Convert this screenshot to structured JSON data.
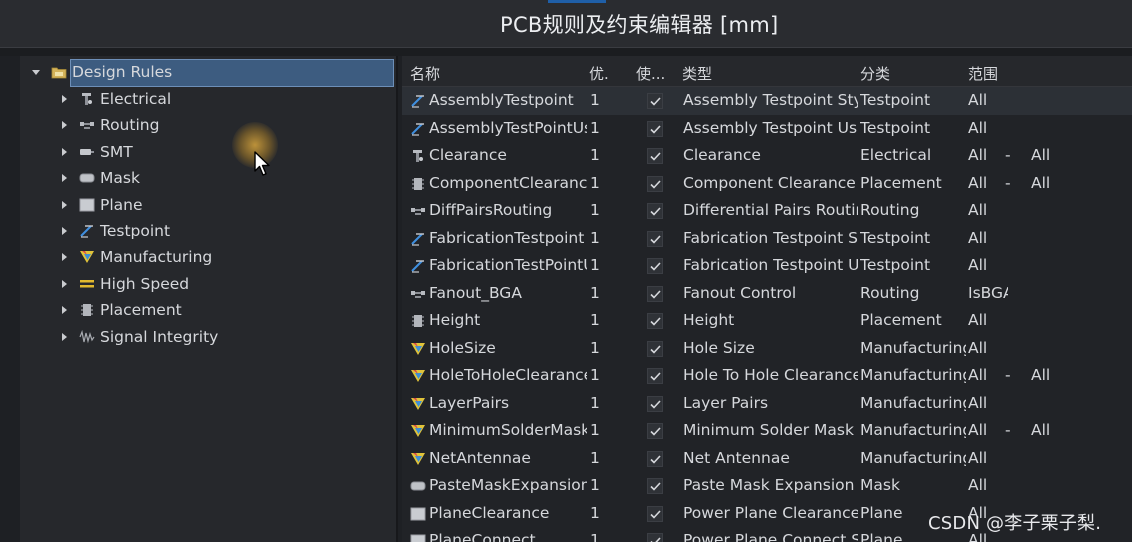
{
  "window": {
    "title": "PCB规则及约束编辑器 [mm]"
  },
  "tree": {
    "root": {
      "label": "Design Rules",
      "icon": "folder-icon"
    },
    "items": [
      {
        "label": "Electrical",
        "icon": "electrical-icon"
      },
      {
        "label": "Routing",
        "icon": "routing-icon"
      },
      {
        "label": "SMT",
        "icon": "smt-icon"
      },
      {
        "label": "Mask",
        "icon": "mask-icon"
      },
      {
        "label": "Plane",
        "icon": "plane-icon"
      },
      {
        "label": "Testpoint",
        "icon": "testpoint-icon"
      },
      {
        "label": "Manufacturing",
        "icon": "manufacturing-icon"
      },
      {
        "label": "High Speed",
        "icon": "high-speed-icon"
      },
      {
        "label": "Placement",
        "icon": "placement-icon"
      },
      {
        "label": "Signal Integrity",
        "icon": "signal-integrity-icon"
      }
    ]
  },
  "grid": {
    "columns": {
      "name": "名称",
      "priority": "优.",
      "enabled": "使...",
      "type": "类型",
      "category": "分类",
      "scope": "范围"
    },
    "rows": [
      {
        "name": "AssemblyTestpoint",
        "priority": "1",
        "enabled": true,
        "type": "Assembly Testpoint Styl",
        "category": "Testpoint",
        "scope1": "All",
        "dash": "",
        "scope2": "",
        "icon": "testpoint-icon"
      },
      {
        "name": "AssemblyTestPointUs",
        "priority": "1",
        "enabled": true,
        "type": "Assembly Testpoint Usa",
        "category": "Testpoint",
        "scope1": "All",
        "dash": "",
        "scope2": "",
        "icon": "testpoint-icon"
      },
      {
        "name": "Clearance",
        "priority": "1",
        "enabled": true,
        "type": "Clearance",
        "category": "Electrical",
        "scope1": "All",
        "dash": "-",
        "scope2": "All",
        "icon": "electrical-icon"
      },
      {
        "name": "ComponentClearance",
        "priority": "1",
        "enabled": true,
        "type": "Component Clearance",
        "category": "Placement",
        "scope1": "All",
        "dash": "-",
        "scope2": "All",
        "icon": "placement-icon"
      },
      {
        "name": "DiffPairsRouting",
        "priority": "1",
        "enabled": true,
        "type": "Differential Pairs Routin",
        "category": "Routing",
        "scope1": "All",
        "dash": "",
        "scope2": "",
        "icon": "routing-icon"
      },
      {
        "name": "FabricationTestpoint",
        "priority": "1",
        "enabled": true,
        "type": "Fabrication Testpoint St",
        "category": "Testpoint",
        "scope1": "All",
        "dash": "",
        "scope2": "",
        "icon": "testpoint-icon"
      },
      {
        "name": "FabricationTestPointU",
        "priority": "1",
        "enabled": true,
        "type": "Fabrication Testpoint U:",
        "category": "Testpoint",
        "scope1": "All",
        "dash": "",
        "scope2": "",
        "icon": "testpoint-icon"
      },
      {
        "name": "Fanout_BGA",
        "priority": "1",
        "enabled": true,
        "type": "Fanout Control",
        "category": "Routing",
        "scope1": "IsBGA",
        "dash": "",
        "scope2": "",
        "icon": "routing-icon"
      },
      {
        "name": "Height",
        "priority": "1",
        "enabled": true,
        "type": "Height",
        "category": "Placement",
        "scope1": "All",
        "dash": "",
        "scope2": "",
        "icon": "placement-icon"
      },
      {
        "name": "HoleSize",
        "priority": "1",
        "enabled": true,
        "type": "Hole Size",
        "category": "Manufacturing",
        "scope1": "All",
        "dash": "",
        "scope2": "",
        "icon": "manufacturing-icon"
      },
      {
        "name": "HoleToHoleClearance",
        "priority": "1",
        "enabled": true,
        "type": "Hole To Hole Clearance",
        "category": "Manufacturing",
        "scope1": "All",
        "dash": "-",
        "scope2": "All",
        "icon": "manufacturing-icon"
      },
      {
        "name": "LayerPairs",
        "priority": "1",
        "enabled": true,
        "type": "Layer Pairs",
        "category": "Manufacturing",
        "scope1": "All",
        "dash": "",
        "scope2": "",
        "icon": "manufacturing-icon"
      },
      {
        "name": "MinimumSolderMask",
        "priority": "1",
        "enabled": true,
        "type": "Minimum Solder Mask !",
        "category": "Manufacturing",
        "scope1": "All",
        "dash": "-",
        "scope2": "All",
        "icon": "manufacturing-icon"
      },
      {
        "name": "NetAntennae",
        "priority": "1",
        "enabled": true,
        "type": "Net Antennae",
        "category": "Manufacturing",
        "scope1": "All",
        "dash": "",
        "scope2": "",
        "icon": "manufacturing-icon"
      },
      {
        "name": "PasteMaskExpansion",
        "priority": "1",
        "enabled": true,
        "type": "Paste Mask Expansion",
        "category": "Mask",
        "scope1": "All",
        "dash": "",
        "scope2": "",
        "icon": "mask-icon"
      },
      {
        "name": "PlaneClearance",
        "priority": "1",
        "enabled": true,
        "type": "Power Plane Clearance",
        "category": "Plane",
        "scope1": "All",
        "dash": "",
        "scope2": "",
        "icon": "plane-icon"
      },
      {
        "name": "PlaneConnect",
        "priority": "1",
        "enabled": true,
        "type": "Power Plane Connect St",
        "category": "Plane",
        "scope1": "All",
        "dash": "",
        "scope2": "",
        "icon": "plane-icon"
      }
    ]
  },
  "watermark": "CSDN @李子栗子梨."
}
